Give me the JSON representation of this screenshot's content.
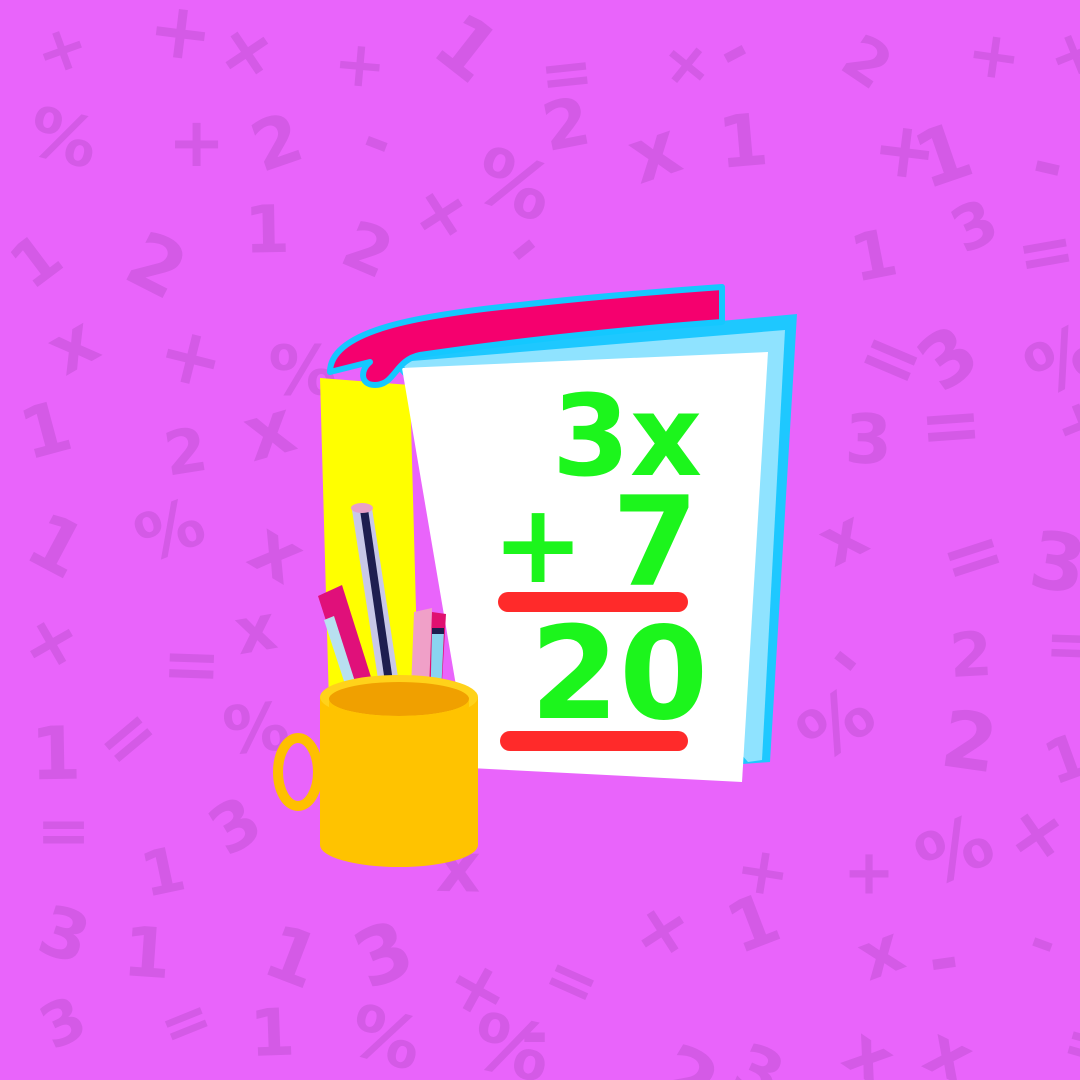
{
  "background": {
    "color": "#e964fb",
    "pattern_color": "#d45ae6",
    "pattern_symbols": [
      "1",
      "2",
      "3",
      "+",
      "=",
      "%",
      "-",
      "x"
    ]
  },
  "flashcard": {
    "line1": "3x",
    "line2_operator": "+",
    "line2_value": "7",
    "result": "20",
    "text_color": "#1cf51c",
    "bar_color": "#ff2a2a"
  }
}
